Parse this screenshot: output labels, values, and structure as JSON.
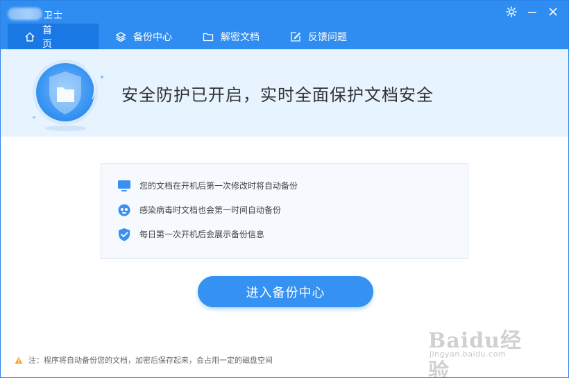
{
  "window": {
    "title_suffix": "卫士"
  },
  "tabs": [
    {
      "label": "首 页",
      "icon": "home-icon",
      "active": true
    },
    {
      "label": "备份中心",
      "icon": "layers-icon",
      "active": false
    },
    {
      "label": "解密文档",
      "icon": "folder-icon",
      "active": false
    },
    {
      "label": "反馈问题",
      "icon": "edit-icon",
      "active": false
    }
  ],
  "banner": {
    "headline": "安全防护已开启，实时全面保护文档安全",
    "icon": "shield-folder-icon"
  },
  "features": [
    {
      "icon": "monitor-icon",
      "text": "您的文档在开机后第一次修改时将自动备份"
    },
    {
      "icon": "virus-icon",
      "text": "感染病毒时文档也会第一时间自动备份"
    },
    {
      "icon": "shield-check-icon",
      "text": "每日第一次开机后会展示备份信息"
    }
  ],
  "main_button": {
    "label": "进入备份中心"
  },
  "footer_note": {
    "icon": "warning-icon",
    "text": "注：程序将自动备份您的文档，加密后保存起来，会占用一定的磁盘空间"
  },
  "watermark": {
    "main": "Baidu经验",
    "sub": "jingyan.baidu.com"
  },
  "colors": {
    "titlebar": "#2f8cf0",
    "active_tab": "#1a78e5",
    "banner_bg": "#e7f3fe",
    "button": "#3592f2",
    "warning": "#f5a623"
  }
}
